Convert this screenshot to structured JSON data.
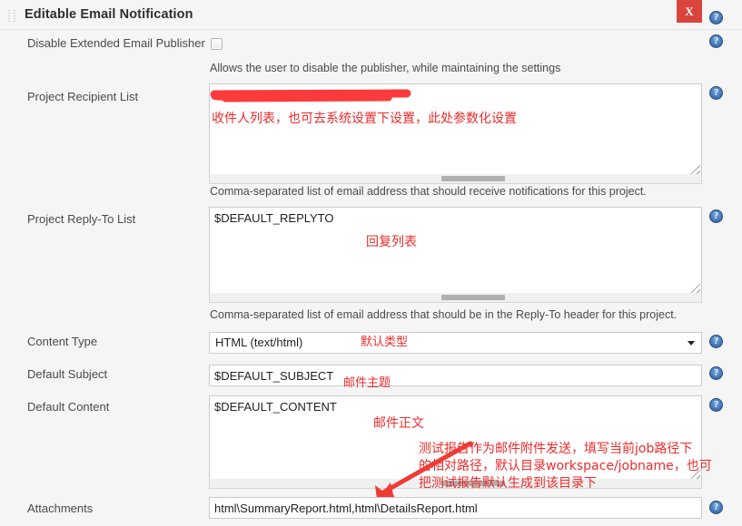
{
  "header": {
    "title": "Editable Email Notification",
    "drag_handle_icon": "grip-dots-icon",
    "close_label": "X",
    "help_icon": "help-question-icon"
  },
  "fields": {
    "disable_publisher": {
      "label": "Disable Extended Email Publisher",
      "checked": false,
      "hint": "Allows the user to disable the publisher, while maintaining the settings"
    },
    "project_recipient_list": {
      "label": "Project Recipient List",
      "value": "",
      "redacted": true,
      "hint": "Comma-separated list of email address that should receive notifications for this project."
    },
    "project_reply_to_list": {
      "label": "Project Reply-To List",
      "value": "$DEFAULT_REPLYTO",
      "hint": "Comma-separated list of email address that should be in the Reply-To header for this project."
    },
    "content_type": {
      "label": "Content Type",
      "selected": "HTML (text/html)",
      "caret_icon": "chevron-down-icon"
    },
    "default_subject": {
      "label": "Default Subject",
      "value": "$DEFAULT_SUBJECT"
    },
    "default_content": {
      "label": "Default Content",
      "value": "$DEFAULT_CONTENT"
    },
    "attachments": {
      "label": "Attachments",
      "value": "html\\SummaryReport.html,html\\DetailsReport.html"
    }
  },
  "annotations": {
    "color": "#ec2b2b",
    "recipient_note": "收件人列表，也可去系统设置下设置，此处参数化设置",
    "replyto_note": "回复列表",
    "content_type_note": "默认类型",
    "subject_note": "邮件主题",
    "content_note": "邮件正文",
    "attachments_note_line1": "测试报告作为邮件附件发送，填写当前job路径下",
    "attachments_note_line2": "的相对路径，默认目录workspace/jobname，也可",
    "attachments_note_line3": "把测试报告默认生成到该目录下",
    "arrow_icon": "red-arrow-pointing-down-left",
    "redaction_icon": "red-scribble-redaction"
  }
}
